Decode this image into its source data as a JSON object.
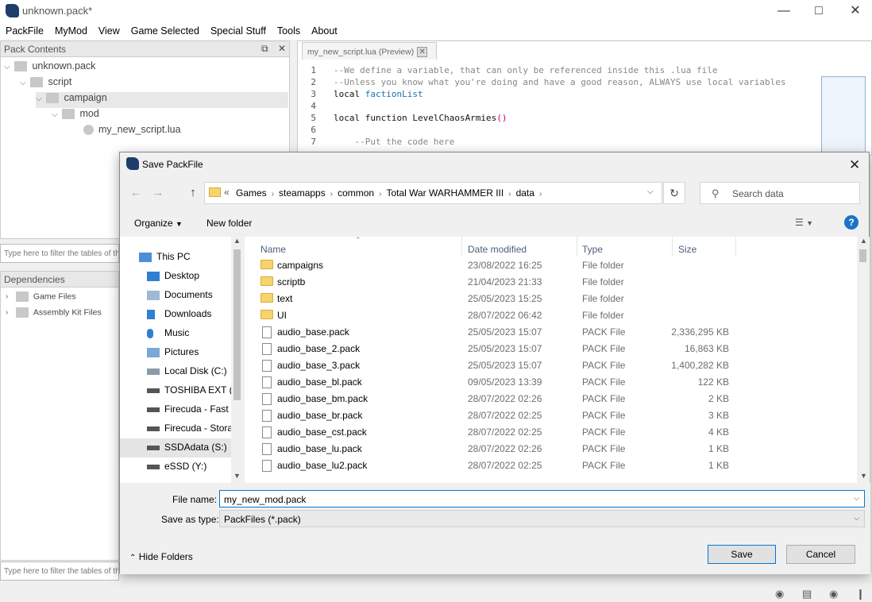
{
  "window": {
    "title": "unknown.pack*"
  },
  "menu": [
    "PackFile",
    "MyMod",
    "View",
    "Game Selected",
    "Special Stuff",
    "Tools",
    "About"
  ],
  "pack_panel": {
    "header": "Pack Contents",
    "tree": [
      {
        "label": "unknown.pack"
      },
      {
        "label": "script"
      },
      {
        "label": "campaign"
      },
      {
        "label": "mod"
      },
      {
        "label": "my_new_script.lua"
      }
    ],
    "filter_placeholder": "Type here to filter the tables of th"
  },
  "dependencies_panel": {
    "header": "Dependencies",
    "items": [
      "Game Files",
      "Assembly Kit Files"
    ],
    "filter_placeholder": "Type here to filter the tables of th"
  },
  "editor": {
    "tab_label": "my_new_script.lua (Preview)",
    "lines": [
      {
        "n": "1",
        "text": "--We define a variable, that can only be referenced inside this .lua file"
      },
      {
        "n": "2",
        "text": "--Unless you know what you're doing and have a good reason, ALWAYS use local variables"
      },
      {
        "n": "3",
        "kw": "local ",
        "id": "factionList"
      },
      {
        "n": "4",
        "text": ""
      },
      {
        "n": "5",
        "kw": "local function LevelChaosArmies",
        "paren": "()"
      },
      {
        "n": "6",
        "text": ""
      },
      {
        "n": "7",
        "text": "    --Put the code here"
      }
    ]
  },
  "dialog": {
    "title": "Save PackFile",
    "breadcrumb": [
      "Games",
      "steamapps",
      "common",
      "Total War WARHAMMER III",
      "data"
    ],
    "search_placeholder": "Search data",
    "organize_label": "Organize",
    "new_folder_label": "New folder",
    "nav": [
      {
        "label": "This PC",
        "icon": "computer-icon"
      },
      {
        "label": "Desktop",
        "icon": "desktop-icon"
      },
      {
        "label": "Documents",
        "icon": "documents-icon"
      },
      {
        "label": "Downloads",
        "icon": "downloads-icon"
      },
      {
        "label": "Music",
        "icon": "music-icon"
      },
      {
        "label": "Pictures",
        "icon": "pictures-icon"
      },
      {
        "label": "Local Disk (C:)",
        "icon": "disk-icon"
      },
      {
        "label": "TOSHIBA EXT (F:",
        "icon": "drive-icon"
      },
      {
        "label": "Firecuda - Fast (",
        "icon": "drive-icon"
      },
      {
        "label": "Firecuda - Storag",
        "icon": "drive-icon"
      },
      {
        "label": "SSDAdata (S:)",
        "icon": "drive-icon"
      },
      {
        "label": "eSSD (Y:)",
        "icon": "drive-icon"
      }
    ],
    "columns": {
      "name": "Name",
      "date": "Date modified",
      "type": "Type",
      "size": "Size"
    },
    "files": [
      {
        "name": "campaigns",
        "date": "23/08/2022 16:25",
        "type": "File folder",
        "size": "",
        "folder": true
      },
      {
        "name": "scriptb",
        "date": "21/04/2023 21:33",
        "type": "File folder",
        "size": "",
        "folder": true
      },
      {
        "name": "text",
        "date": "25/05/2023 15:25",
        "type": "File folder",
        "size": "",
        "folder": true
      },
      {
        "name": "UI",
        "date": "28/07/2022 06:42",
        "type": "File folder",
        "size": "",
        "folder": true
      },
      {
        "name": "audio_base.pack",
        "date": "25/05/2023 15:07",
        "type": "PACK File",
        "size": "2,336,295 KB",
        "folder": false
      },
      {
        "name": "audio_base_2.pack",
        "date": "25/05/2023 15:07",
        "type": "PACK File",
        "size": "16,863 KB",
        "folder": false
      },
      {
        "name": "audio_base_3.pack",
        "date": "25/05/2023 15:07",
        "type": "PACK File",
        "size": "1,400,282 KB",
        "folder": false
      },
      {
        "name": "audio_base_bl.pack",
        "date": "09/05/2023 13:39",
        "type": "PACK File",
        "size": "122 KB",
        "folder": false
      },
      {
        "name": "audio_base_bm.pack",
        "date": "28/07/2022 02:26",
        "type": "PACK File",
        "size": "2 KB",
        "folder": false
      },
      {
        "name": "audio_base_br.pack",
        "date": "28/07/2022 02:25",
        "type": "PACK File",
        "size": "3 KB",
        "folder": false
      },
      {
        "name": "audio_base_cst.pack",
        "date": "28/07/2022 02:25",
        "type": "PACK File",
        "size": "4 KB",
        "folder": false
      },
      {
        "name": "audio_base_lu.pack",
        "date": "28/07/2022 02:26",
        "type": "PACK File",
        "size": "1 KB",
        "folder": false
      },
      {
        "name": "audio_base_lu2.pack",
        "date": "28/07/2022 02:25",
        "type": "PACK File",
        "size": "1 KB",
        "folder": false
      }
    ],
    "file_name_label": "File name:",
    "file_name_value": "my_new_mod.pack",
    "save_type_label": "Save as type:",
    "save_type_value": "PackFiles (*.pack)",
    "hide_folders_label": "Hide Folders",
    "save_label": "Save",
    "cancel_label": "Cancel",
    "help_label": "?"
  }
}
